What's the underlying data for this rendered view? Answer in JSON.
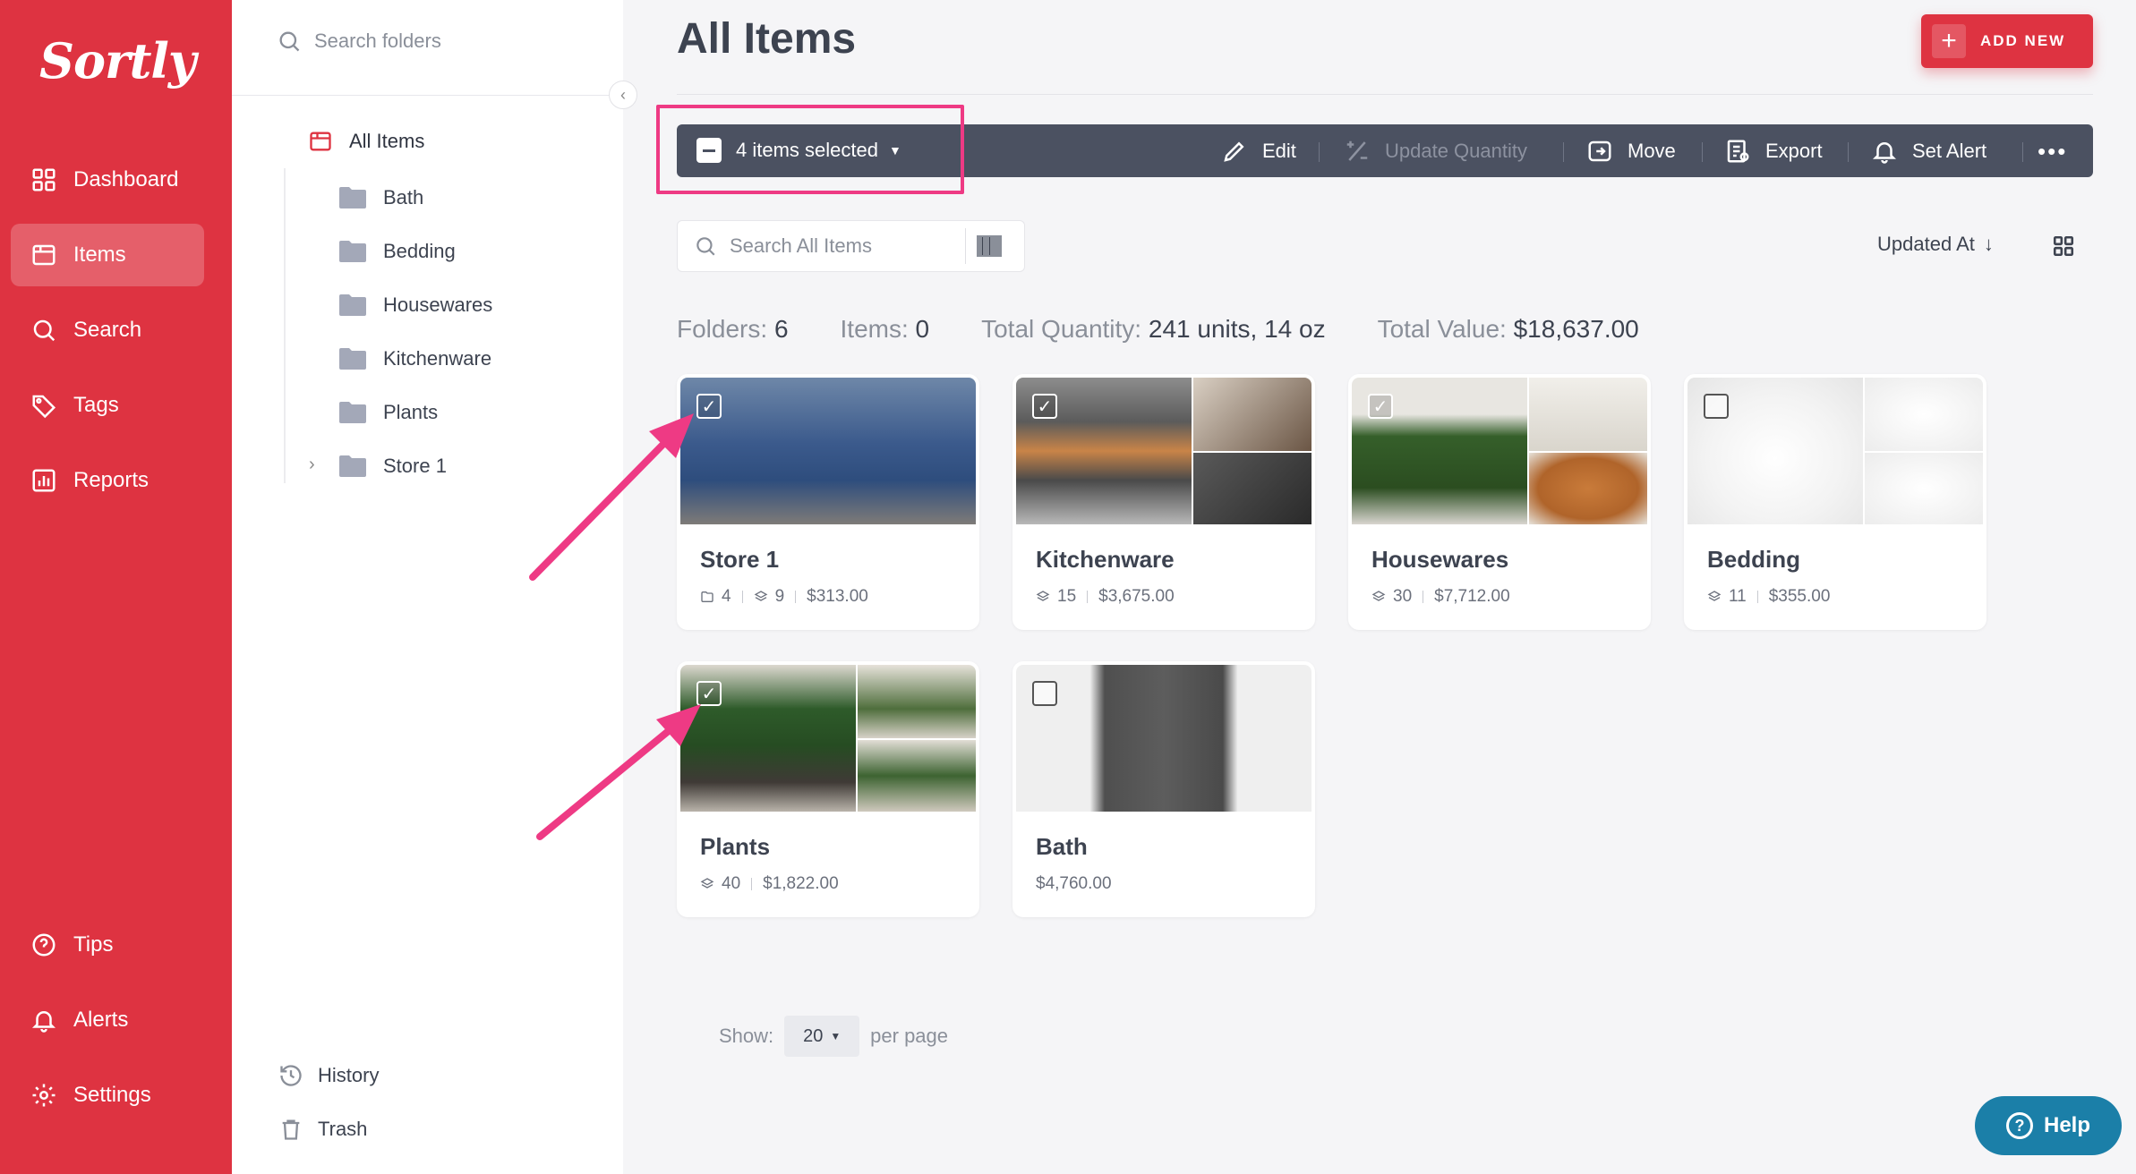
{
  "brand": {
    "logo": "Sortly",
    "color": "#de3341"
  },
  "nav": {
    "items": [
      {
        "label": "Dashboard",
        "icon": "dashboard-icon"
      },
      {
        "label": "Items",
        "icon": "items-icon",
        "active": true
      },
      {
        "label": "Search",
        "icon": "search-icon"
      },
      {
        "label": "Tags",
        "icon": "tag-icon"
      },
      {
        "label": "Reports",
        "icon": "reports-icon"
      },
      {
        "label": "Tips",
        "icon": "help-circle-icon"
      },
      {
        "label": "Alerts",
        "icon": "bell-icon"
      },
      {
        "label": "Settings",
        "icon": "gear-icon"
      }
    ]
  },
  "folders_panel": {
    "search_placeholder": "Search folders",
    "root": "All Items",
    "folders": [
      "Bath",
      "Bedding",
      "Housewares",
      "Kitchenware",
      "Plants",
      "Store 1"
    ],
    "history": "History",
    "trash": "Trash"
  },
  "main": {
    "title": "All Items",
    "add_new": "ADD NEW",
    "toolbar": {
      "selected": "4 items selected",
      "edit": "Edit",
      "update_quantity": "Update Quantity",
      "move": "Move",
      "export": "Export",
      "set_alert": "Set Alert"
    },
    "search_placeholder": "Search All Items",
    "sort_label": "Updated At",
    "summary": {
      "folders_label": "Folders:",
      "folders": "6",
      "items_label": "Items:",
      "items": "0",
      "qty_label": "Total Quantity:",
      "qty": "241 units, 14 oz",
      "value_label": "Total Value:",
      "value": "$18,637.00"
    },
    "cards": [
      {
        "name": "Store 1",
        "folders": "4",
        "units": "9",
        "value": "$313.00",
        "checked": true
      },
      {
        "name": "Kitchenware",
        "units": "15",
        "value": "$3,675.00",
        "checked": true
      },
      {
        "name": "Housewares",
        "units": "30",
        "value": "$7,712.00",
        "checked": true
      },
      {
        "name": "Bedding",
        "units": "11",
        "value": "$355.00",
        "checked": false
      },
      {
        "name": "Plants",
        "units": "40",
        "value": "$1,822.00",
        "checked": true
      },
      {
        "name": "Bath",
        "value": "$4,760.00",
        "checked": false
      }
    ],
    "pagination": {
      "show_label": "Show:",
      "page_size": "20",
      "per_page": "per page"
    }
  },
  "help": {
    "label": "Help"
  },
  "annotation_color": "#ee3a84"
}
